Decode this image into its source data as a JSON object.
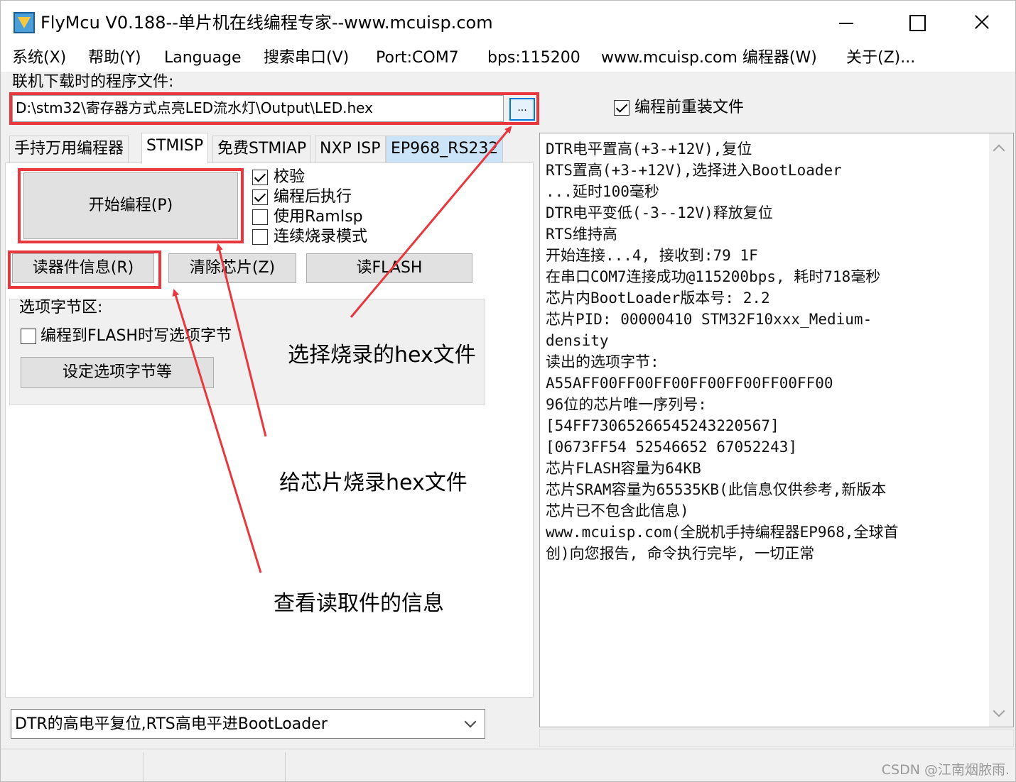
{
  "window": {
    "title": "FlyMcu V0.188--单片机在线编程专家--www.mcuisp.com"
  },
  "menu": [
    "系统(X)",
    "帮助(Y)",
    "Language",
    "搜索串口(V)",
    "Port:COM7",
    "bps:115200",
    "www.mcuisp.com 编程器(W)",
    "关于(Z)..."
  ],
  "file": {
    "label": "联机下载时的程序文件:",
    "path": "D:\\stm32\\寄存器方式点亮LED流水灯\\Output\\LED.hex",
    "browse_label": "...",
    "reload_label": "编程前重装文件",
    "reload_checked": true
  },
  "tabs": [
    "手持万用编程器",
    "STMISP",
    "免费STMIAP",
    "NXP ISP",
    "EP968_RS232"
  ],
  "active_tab": "STMISP",
  "program_button": "开始编程(P)",
  "options": [
    {
      "label": "校验",
      "checked": true
    },
    {
      "label": "编程后执行",
      "checked": true
    },
    {
      "label": "使用RamIsp",
      "checked": false
    },
    {
      "label": "连续烧录模式",
      "checked": false
    }
  ],
  "buttons": {
    "read_info": "读器件信息(R)",
    "erase": "清除芯片(Z)",
    "read_flash": "读FLASH"
  },
  "option_bytes": {
    "title": "选项字节区:",
    "write_on_flash": "编程到FLASH时写选项字节",
    "write_checked": false,
    "set_button": "设定选项字节等"
  },
  "annotations": {
    "select_hex": "选择烧录的hex文件",
    "burn_hex": "给芯片烧录hex文件",
    "read_info": "查看读取件的信息"
  },
  "reset_mode": "DTR的高电平复位,RTS高电平进BootLoader",
  "log_lines": [
    "DTR电平置高(+3-+12V),复位",
    "RTS置高(+3-+12V),选择进入BootLoader",
    "...延时100毫秒",
    "DTR电平变低(-3--12V)释放复位",
    "RTS维持高",
    "开始连接...4, 接收到:79 1F",
    "在串口COM7连接成功@115200bps, 耗时718毫秒",
    "芯片内BootLoader版本号: 2.2",
    "芯片PID: 00000410  STM32F10xxx_Medium-",
    "density",
    "读出的选项字节:",
    "A55AFF00FF00FF00FF00FF00FF00FF00",
    "96位的芯片唯一序列号:",
    "[54FF73065266545243220567]",
    "[0673FF54 52546652 67052243]",
    "芯片FLASH容量为64KB",
    "芯片SRAM容量为65535KB(此信息仅供参考,新版本",
    "芯片已不包含此信息)",
    "www.mcuisp.com(全脱机手持编程器EP968,全球首",
    "创)向您报告, 命令执行完毕, 一切正常"
  ],
  "watermark": "CSDN @江南烟脓雨.",
  "colors": {
    "annotation": "#e8383d",
    "active_button_border": "#0078d7",
    "tab_highlight": "#cce4f7"
  }
}
